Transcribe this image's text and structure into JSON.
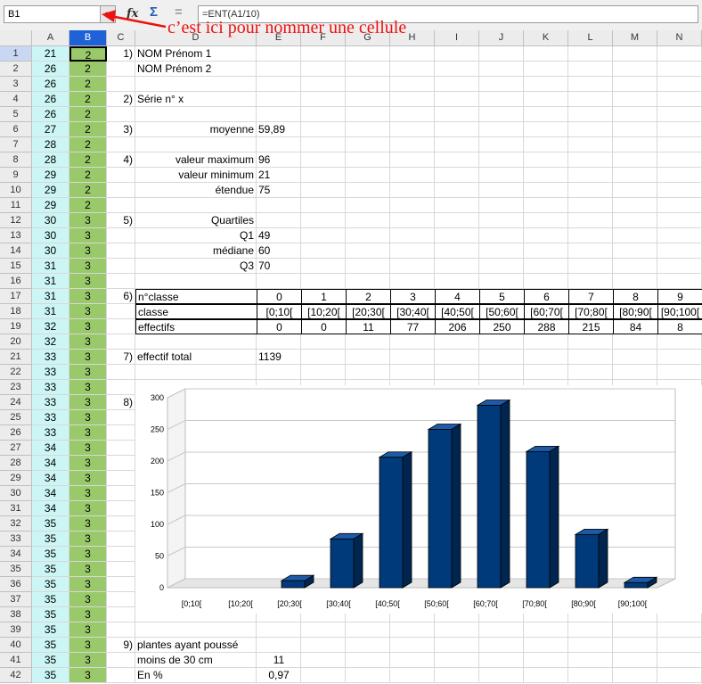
{
  "namebox": {
    "value": "B1"
  },
  "toolbar": {
    "fx": "fx",
    "sum": "Σ",
    "eq": "="
  },
  "formula": {
    "text": "=ENT(A1/10)"
  },
  "annotation": {
    "text": "c’est ici pour nommer une cellule"
  },
  "columns": [
    "A",
    "B",
    "C",
    "D",
    "E",
    "F",
    "G",
    "H",
    "I",
    "J",
    "K",
    "L",
    "M",
    "N"
  ],
  "rows": [
    {
      "n": "1",
      "a": "21",
      "b": "2"
    },
    {
      "n": "2",
      "a": "26",
      "b": "2"
    },
    {
      "n": "3",
      "a": "26",
      "b": "2"
    },
    {
      "n": "4",
      "a": "26",
      "b": "2"
    },
    {
      "n": "5",
      "a": "26",
      "b": "2"
    },
    {
      "n": "6",
      "a": "27",
      "b": "2"
    },
    {
      "n": "7",
      "a": "28",
      "b": "2"
    },
    {
      "n": "8",
      "a": "28",
      "b": "2"
    },
    {
      "n": "9",
      "a": "29",
      "b": "2"
    },
    {
      "n": "10",
      "a": "29",
      "b": "2"
    },
    {
      "n": "11",
      "a": "29",
      "b": "2"
    },
    {
      "n": "12",
      "a": "30",
      "b": "3"
    },
    {
      "n": "13",
      "a": "30",
      "b": "3"
    },
    {
      "n": "14",
      "a": "30",
      "b": "3"
    },
    {
      "n": "15",
      "a": "31",
      "b": "3"
    },
    {
      "n": "16",
      "a": "31",
      "b": "3"
    },
    {
      "n": "17",
      "a": "31",
      "b": "3"
    },
    {
      "n": "18",
      "a": "31",
      "b": "3"
    },
    {
      "n": "19",
      "a": "32",
      "b": "3"
    },
    {
      "n": "20",
      "a": "32",
      "b": "3"
    },
    {
      "n": "21",
      "a": "33",
      "b": "3"
    },
    {
      "n": "22",
      "a": "33",
      "b": "3"
    },
    {
      "n": "23",
      "a": "33",
      "b": "3"
    },
    {
      "n": "24",
      "a": "33",
      "b": "3"
    },
    {
      "n": "25",
      "a": "33",
      "b": "3"
    },
    {
      "n": "26",
      "a": "33",
      "b": "3"
    },
    {
      "n": "27",
      "a": "34",
      "b": "3"
    },
    {
      "n": "28",
      "a": "34",
      "b": "3"
    },
    {
      "n": "29",
      "a": "34",
      "b": "3"
    },
    {
      "n": "30",
      "a": "34",
      "b": "3"
    },
    {
      "n": "31",
      "a": "34",
      "b": "3"
    },
    {
      "n": "32",
      "a": "35",
      "b": "3"
    },
    {
      "n": "33",
      "a": "35",
      "b": "3"
    },
    {
      "n": "34",
      "a": "35",
      "b": "3"
    },
    {
      "n": "35",
      "a": "35",
      "b": "3"
    },
    {
      "n": "36",
      "a": "35",
      "b": "3"
    },
    {
      "n": "37",
      "a": "35",
      "b": "3"
    },
    {
      "n": "38",
      "a": "35",
      "b": "3"
    },
    {
      "n": "39",
      "a": "35",
      "b": "3"
    },
    {
      "n": "40",
      "a": "35",
      "b": "3"
    },
    {
      "n": "41",
      "a": "35",
      "b": "3"
    },
    {
      "n": "42",
      "a": "35",
      "b": "3"
    }
  ],
  "labels": {
    "q1": "1)",
    "name1": "NOM Prénom 1",
    "name2": "NOM Prénom 2",
    "q2": "2)",
    "serie": "Série n° x",
    "q3": "3)",
    "moyenne": "moyenne",
    "moyenne_val": "59,89",
    "q4": "4)",
    "vmax": "valeur maximum",
    "vmax_val": "96",
    "vmin": "valeur minimum",
    "vmin_val": "21",
    "etendue": "étendue",
    "etendue_val": "75",
    "q5": "5)",
    "quartiles": "Quartiles",
    "Q1": "Q1",
    "Q1_val": "49",
    "mediane": "médiane",
    "mediane_val": "60",
    "Q3": "Q3",
    "Q3_val": "70",
    "q6": "6)",
    "nclasse": "n°classe",
    "classe": "classe",
    "effectifs": "effectifs",
    "q7": "7)",
    "efftotal": "effectif total",
    "efftotal_val": "1139",
    "q8": "8)",
    "q9": "9)",
    "plantes": "plantes ayant poussé",
    "moins30": "moins de 30 cm",
    "moins30_val": "11",
    "enpct": "En %",
    "enpct_val": "0,97"
  },
  "table": {
    "nums": [
      "0",
      "1",
      "2",
      "3",
      "4",
      "5",
      "6",
      "7",
      "8",
      "9"
    ],
    "classes": [
      "[0;10[",
      "[10;20[",
      "[20;30[",
      "[30;40[",
      "[40;50[",
      "[50;60[",
      "[60;70[",
      "[70;80[",
      "[80;90[",
      "[90;100["
    ],
    "effectifs": [
      "0",
      "0",
      "11",
      "77",
      "206",
      "250",
      "288",
      "215",
      "84",
      "8"
    ]
  },
  "chart_data": {
    "type": "bar",
    "categories": [
      "[0;10[",
      "[10;20[",
      "[20;30[",
      "[30;40[",
      "[40;50[",
      "[50;60[",
      "[60;70[",
      "[70;80[",
      "[80;90[",
      "[90;100["
    ],
    "values": [
      0,
      0,
      11,
      77,
      206,
      250,
      288,
      215,
      84,
      8
    ],
    "ylim": [
      0,
      300
    ],
    "yticks": [
      0,
      50,
      100,
      150,
      200,
      250,
      300
    ],
    "grid": true,
    "bar_color": "#003a7a",
    "bar_side_color": "#002650"
  },
  "colors": {
    "colA": "#ccf6f6",
    "colB": "#99c96a",
    "selected_header": "#1f62d8",
    "annotation": "#ee1111"
  }
}
